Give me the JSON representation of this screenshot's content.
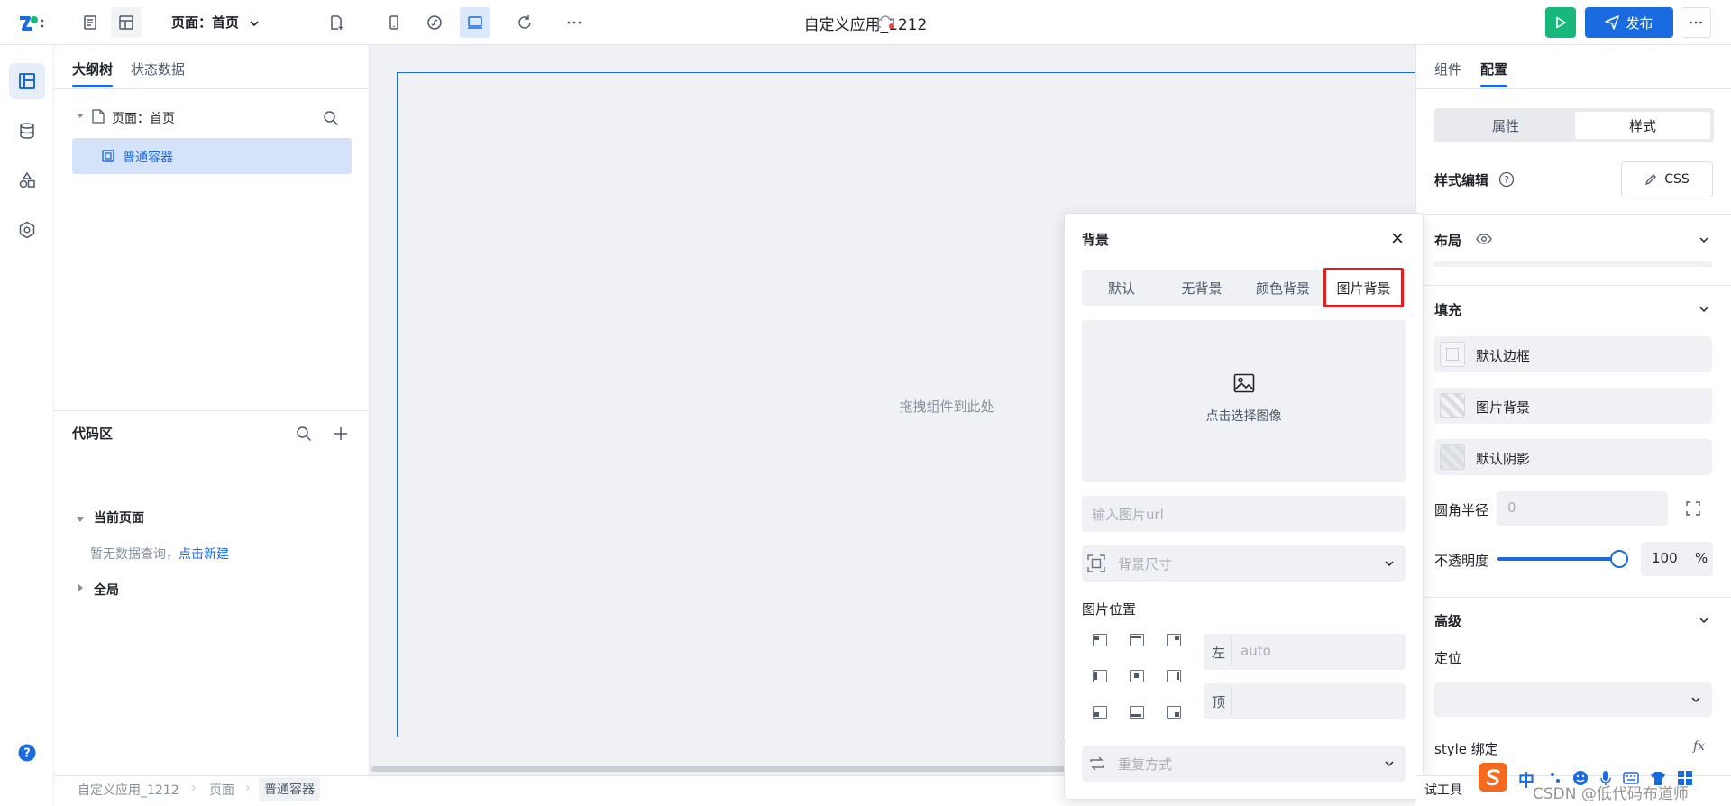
{
  "topbar": {
    "page_select": "页面：首页",
    "app_title": "自定义应用_1212",
    "publish_label": "发布"
  },
  "left_panel": {
    "tabs": [
      "大纲树",
      "状态数据"
    ],
    "tree_root": "页面：首页",
    "tree_selected": "普通容器",
    "code_title": "代码区",
    "current_page": "当前页面",
    "empty_query": "暂无数据查询，",
    "create_link": "点击新建",
    "global": "全局"
  },
  "canvas": {
    "drop_hint": "拖拽组件到此处"
  },
  "breadcrumb": [
    "自定义应用_1212",
    "页面",
    "普通容器"
  ],
  "popover": {
    "title": "背景",
    "tabs": [
      "默认",
      "无背景",
      "颜色背景",
      "图片背景"
    ],
    "active_tab": "图片背景",
    "pick_image": "点击选择图像",
    "url_placeholder": "输入图片url",
    "size_placeholder": "背景尺寸",
    "position_label": "图片位置",
    "left_label": "左",
    "left_value": "auto",
    "top_label": "顶",
    "repeat_placeholder": "重复方式"
  },
  "right_panel": {
    "tabs": [
      "组件",
      "配置"
    ],
    "segments": [
      "属性",
      "样式"
    ],
    "style_edit": "样式编辑",
    "css_button": "CSS",
    "layout": "布局",
    "fill": "填充",
    "fill_items": [
      "默认边框",
      "图片背景",
      "默认阴影"
    ],
    "radius_label": "圆角半径",
    "radius_value": "0",
    "opacity_label": "不透明度",
    "opacity_value": "100",
    "opacity_unit": "%",
    "opacity_level": 1.0,
    "advanced": "高级",
    "position": "定位",
    "style_binding": "style 绑定",
    "fx": "fx"
  },
  "bottom_overlay": {
    "partial_tools": "试工具",
    "ime_char": "中",
    "watermark": "CSDN @低代码布道师"
  },
  "colors": {
    "primary": "#1b6be0",
    "run_green": "#18b87c",
    "highlight_red": "#e02020"
  }
}
